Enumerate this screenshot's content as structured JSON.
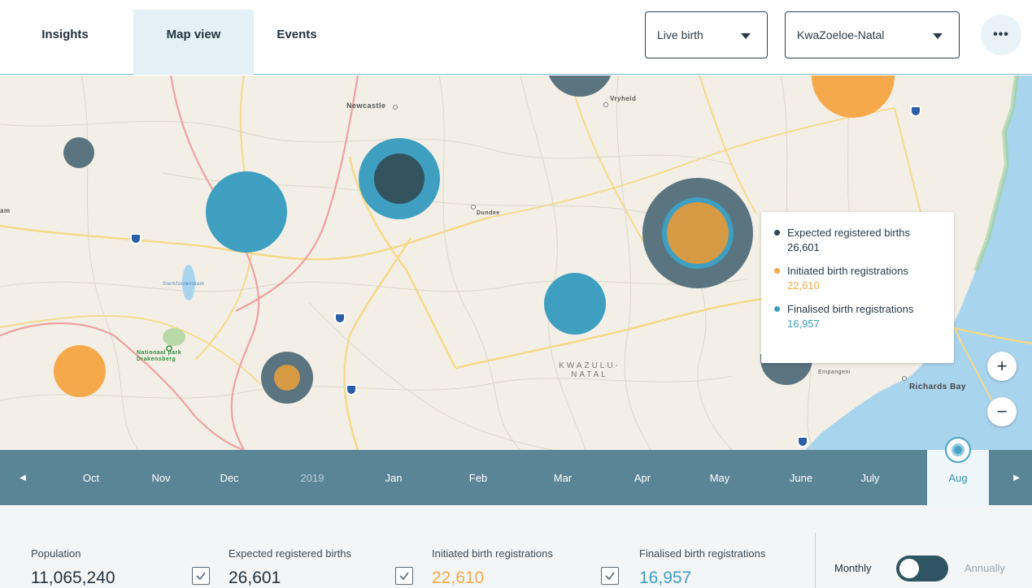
{
  "tabs": [
    {
      "label": "Insights",
      "active": false
    },
    {
      "label": "Map view",
      "active": true
    },
    {
      "label": "Events",
      "active": false
    }
  ],
  "filters": {
    "event_type": "Live birth",
    "region": "KwaZoeloe-Natal"
  },
  "more_label": "•••",
  "map": {
    "place_labels": {
      "newcastle": "Newcastle",
      "vryheid": "Vryheid",
      "dundee": "Dundee",
      "kwazulu_line1": "KWAZULU-",
      "kwazulu_line2": "NATAL",
      "richards_bay": "Richards Bay",
      "empangeni": "Empangeni",
      "park_line1": "Nationaal park",
      "park_line2": "Drakensberg",
      "lake": "Sterkfonteindam",
      "edge": "am"
    },
    "tooltip": {
      "expected_label": "Expected registered births",
      "expected_value": "26,601",
      "initiated_label": "Initiated birth registrations",
      "initiated_value": "22,610",
      "finalised_label": "Finalised birth registrations",
      "finalised_value": "16,957"
    },
    "zoom_in": "+",
    "zoom_out": "−"
  },
  "timeline": {
    "prev": "◀",
    "next": "▶",
    "months": [
      "Oct",
      "Nov",
      "Dec",
      "2019",
      "Jan",
      "Feb",
      "Mar",
      "Apr",
      "May",
      "June",
      "July",
      "Aug"
    ],
    "active": "Aug"
  },
  "stats": {
    "population_label": "Population",
    "population_value": "11,065,240",
    "expected_label": "Expected registered births",
    "expected_value": "26,601",
    "initiated_label": "Initiated birth registrations",
    "initiated_value": "22,610",
    "finalised_label": "Finalised birth registrations",
    "finalised_value": "16,957"
  },
  "toggle": {
    "left_label": "Monthly",
    "right_label": "Annually"
  },
  "colors": {
    "expected": "#5a7480",
    "initiated": "#f5a94a",
    "finalised": "#3e9fc0",
    "accent": "#4aa3c6"
  }
}
